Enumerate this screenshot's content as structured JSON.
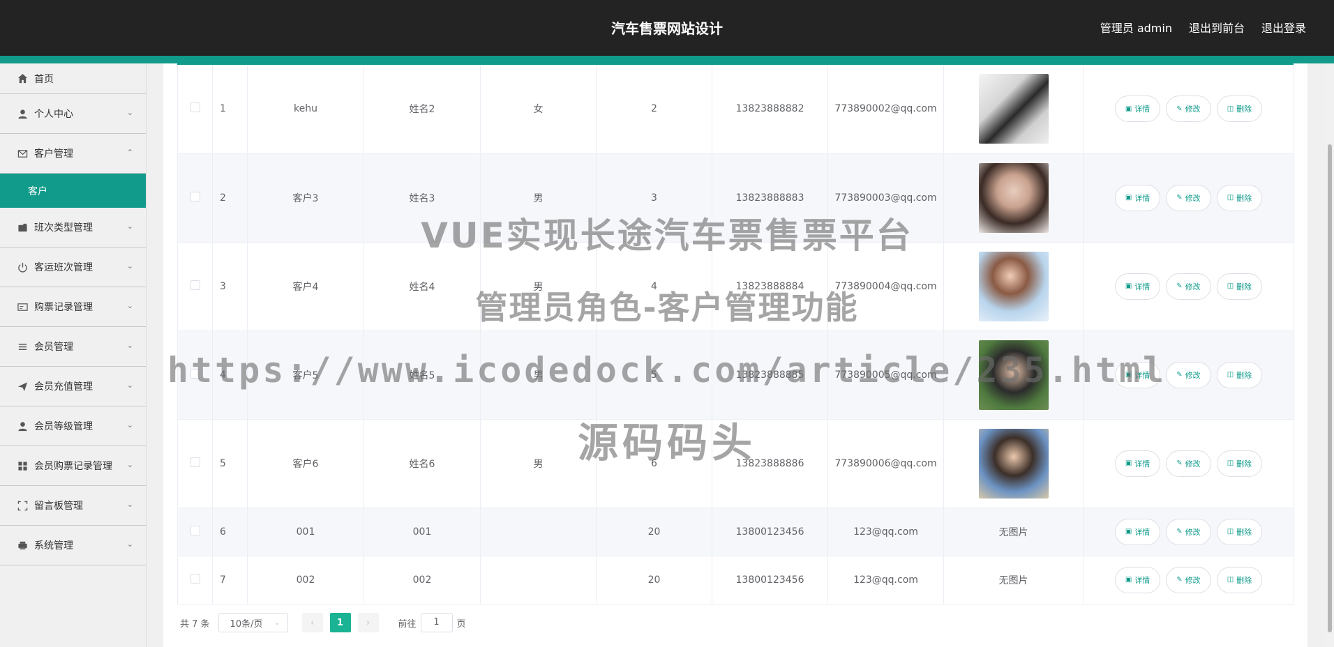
{
  "header": {
    "title": "汽车售票网站设计",
    "user": "管理员 admin",
    "to_front": "退出到前台",
    "logout": "退出登录"
  },
  "sidebar": {
    "items": [
      {
        "label": "首页",
        "icon": "home-icon"
      },
      {
        "label": "个人中心",
        "icon": "user-icon"
      },
      {
        "label": "客户管理",
        "icon": "mail-icon",
        "expanded": true
      },
      {
        "label": "班次类型管理",
        "icon": "wallet-icon"
      },
      {
        "label": "客运班次管理",
        "icon": "power-icon"
      },
      {
        "label": "购票记录管理",
        "icon": "card-icon"
      },
      {
        "label": "会员管理",
        "icon": "list-icon"
      },
      {
        "label": "会员充值管理",
        "icon": "send-icon"
      },
      {
        "label": "会员等级管理",
        "icon": "user-icon"
      },
      {
        "label": "会员购票记录管理",
        "icon": "grid-icon"
      },
      {
        "label": "留言板管理",
        "icon": "fullscreen-icon"
      },
      {
        "label": "系统管理",
        "icon": "printer-icon"
      }
    ],
    "submenu_active": "客户"
  },
  "table": {
    "rows": [
      {
        "index": "1",
        "account": "kehu",
        "name": "姓名2",
        "gender": "女",
        "age": "2",
        "phone": "13823888882",
        "email": "773890002@qq.com",
        "photo": "ph1"
      },
      {
        "index": "2",
        "account": "客户3",
        "name": "姓名3",
        "gender": "男",
        "age": "3",
        "phone": "13823888883",
        "email": "773890003@qq.com",
        "photo": "ph2"
      },
      {
        "index": "3",
        "account": "客户4",
        "name": "姓名4",
        "gender": "男",
        "age": "4",
        "phone": "13823888884",
        "email": "773890004@qq.com",
        "photo": "ph3"
      },
      {
        "index": "4",
        "account": "客户5",
        "name": "姓名5",
        "gender": "男",
        "age": "5",
        "phone": "13823888885",
        "email": "773890005@qq.com",
        "photo": "ph4"
      },
      {
        "index": "5",
        "account": "客户6",
        "name": "姓名6",
        "gender": "男",
        "age": "6",
        "phone": "13823888886",
        "email": "773890006@qq.com",
        "photo": "ph5"
      },
      {
        "index": "6",
        "account": "001",
        "name": "001",
        "gender": "",
        "age": "20",
        "phone": "13800123456",
        "email": "123@qq.com",
        "photo": "",
        "photo_text": "无图片"
      },
      {
        "index": "7",
        "account": "002",
        "name": "002",
        "gender": "",
        "age": "20",
        "phone": "13800123456",
        "email": "123@qq.com",
        "photo": "",
        "photo_text": "无图片"
      }
    ],
    "actions": {
      "detail": "详情",
      "edit": "修改",
      "delete": "删除"
    }
  },
  "pagination": {
    "total": "共 7 条",
    "page_size": "10条/页",
    "current_page": "1",
    "goto_label": "前往",
    "goto_value": "1",
    "page_suffix": "页"
  },
  "watermark": {
    "line1": "VUE实现长途汽车票售票平台",
    "line2": "管理员角色-客户管理功能",
    "line3": "https://www.icodedock.com/article/235.html",
    "line4": "源码码头"
  }
}
